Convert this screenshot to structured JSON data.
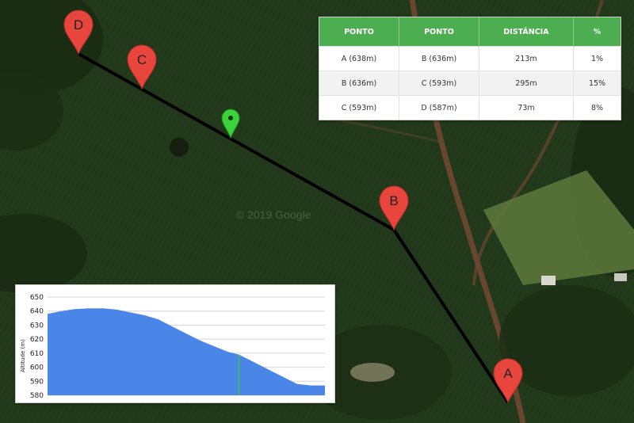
{
  "map": {
    "watermark": "© 2019 Google",
    "markers": [
      {
        "label": "D"
      },
      {
        "label": "C"
      },
      {
        "label": "B"
      },
      {
        "label": "A"
      }
    ],
    "current_marker": "green-pin",
    "colors": {
      "route": "#000000",
      "pin": "#e8453c",
      "current_pin": "#3bd23b"
    }
  },
  "table": {
    "headers": [
      "PONTO",
      "PONTO",
      "DISTÂNCIA",
      "%"
    ],
    "rows": [
      [
        "A (638m)",
        "B (636m)",
        "213m",
        "1%"
      ],
      [
        "B (636m)",
        "C (593m)",
        "295m",
        "15%"
      ],
      [
        "C (593m)",
        "D (587m)",
        "73m",
        "8%"
      ]
    ],
    "header_color": "#4cae50"
  },
  "chart_data": {
    "type": "area",
    "ylabel": "Altitude (m)",
    "xlabel": "",
    "ylim": [
      580,
      650
    ],
    "yticks": [
      580,
      590,
      600,
      610,
      620,
      630,
      640,
      650
    ],
    "grid": true,
    "fill_color": "#4a86e8",
    "marker_color": "#3cc83c",
    "marker_x": 0.69,
    "x": [
      0,
      0.05,
      0.1,
      0.15,
      0.2,
      0.25,
      0.3,
      0.35,
      0.4,
      0.45,
      0.5,
      0.55,
      0.6,
      0.65,
      0.69,
      0.75,
      0.8,
      0.85,
      0.9,
      0.95,
      1.0
    ],
    "values": [
      638,
      640,
      641.5,
      642,
      642,
      641,
      639,
      637,
      634,
      629,
      624,
      619,
      615,
      611,
      609,
      603,
      598,
      593,
      588,
      587,
      587
    ]
  }
}
